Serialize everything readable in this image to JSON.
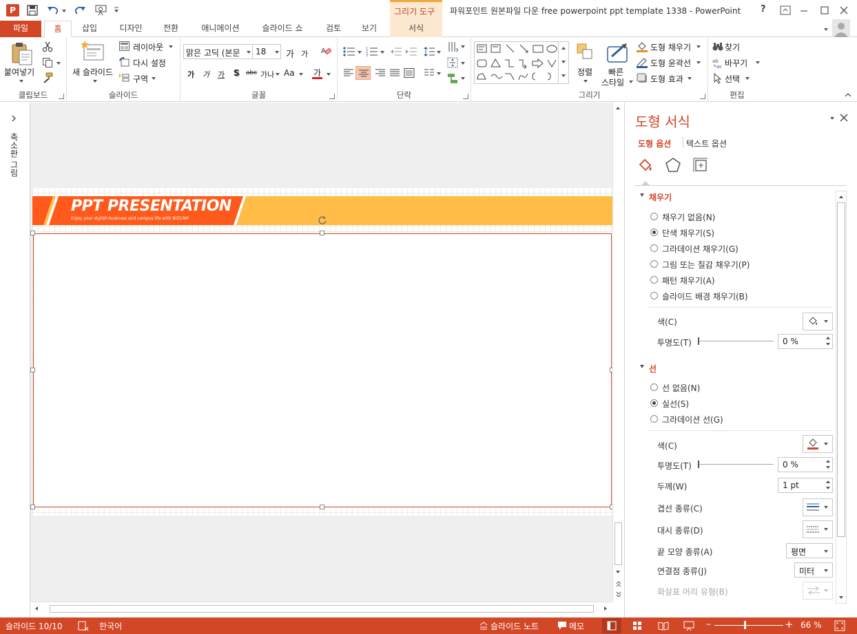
{
  "app": {
    "window_title": "파워포인트 원본파일 다운 free powerpoint ppt template 1338 - PowerPoint",
    "context_tab_group": "그리기 도구",
    "help_label": "?",
    "colors": {
      "accent": "#d24726",
      "banner_orange": "#ff5a1c",
      "banner_yellow": "#ffbc46",
      "context_bg": "#fde9cf"
    }
  },
  "tabs": [
    {
      "label": "파일"
    },
    {
      "label": "홈"
    },
    {
      "label": "삽입"
    },
    {
      "label": "디자인"
    },
    {
      "label": "전환"
    },
    {
      "label": "애니메이션"
    },
    {
      "label": "슬라이드 쇼"
    },
    {
      "label": "검토"
    },
    {
      "label": "보기"
    },
    {
      "label": "서식"
    }
  ],
  "ribbon": {
    "clipboard": {
      "label": "클립보드",
      "paste": "붙여넣기"
    },
    "slides": {
      "label": "슬라이드",
      "new_slide": "새 슬라이드",
      "layout": "레이아웃",
      "reset": "다시 설정",
      "section": "구역"
    },
    "font": {
      "label": "글꼴",
      "font_name": "맑은 고딕 (본문",
      "font_size": "18",
      "grow": "가",
      "shrink": "가",
      "bold": "가",
      "italic": "가",
      "underline": "가",
      "shadow": "S",
      "strike": "abc",
      "spacing": "가나",
      "case": "Aa",
      "color": "가"
    },
    "paragraph": {
      "label": "단락"
    },
    "drawing": {
      "label": "그리기",
      "arrange": "정렬",
      "quick_styles": "빠른",
      "quick_styles2": "스타일",
      "fill": "도형 채우기",
      "outline": "도형 윤곽선",
      "effects": "도형 효과"
    },
    "editing": {
      "label": "편집",
      "find": "찾기",
      "replace": "바꾸기",
      "select": "선택"
    }
  },
  "left_strip": {
    "label": "축소판 그림"
  },
  "slide": {
    "banner_title": "PPT PRESENTATION",
    "banner_subtitle": "Enjoy your stylish business and campus life with BIZCAM"
  },
  "pane": {
    "title": "도형 서식",
    "tab_shape": "도형 옵션",
    "tab_text": "텍스트 옵션",
    "fill": {
      "header": "채우기",
      "options": [
        {
          "label": "채우기 없음(N)",
          "selected": false
        },
        {
          "label": "단색 채우기(S)",
          "selected": true
        },
        {
          "label": "그라데이션 채우기(G)",
          "selected": false
        },
        {
          "label": "그림 또는 질감 채우기(P)",
          "selected": false
        },
        {
          "label": "패턴 채우기(A)",
          "selected": false
        },
        {
          "label": "슬라이드 배경 채우기(B)",
          "selected": false
        }
      ],
      "color_label": "색(C)",
      "transparency_label": "투명도(T)",
      "transparency_value": "0 %"
    },
    "line": {
      "header": "선",
      "options": [
        {
          "label": "선 없음(N)",
          "selected": false
        },
        {
          "label": "실선(S)",
          "selected": true
        },
        {
          "label": "그라데이션 선(G)",
          "selected": false
        }
      ],
      "color_label": "색(C)",
      "transparency_label": "투명도(T)",
      "transparency_value": "0 %",
      "width_label": "두께(W)",
      "width_value": "1 pt",
      "compound_label": "겹선 종류(C)",
      "dash_label": "대시 종류(D)",
      "cap_label": "끝 모양 종류(A)",
      "cap_value": "평면",
      "join_label": "연결점 종류(J)",
      "join_value": "미터",
      "arrow_label": "화살표 머리 유형(B)"
    }
  },
  "status": {
    "slide_info": "슬라이드 10/10",
    "language": "한국어",
    "notes": "슬라이드 노트",
    "comments": "메모",
    "zoom": "66 %",
    "zoom_fraction": 0.44
  }
}
